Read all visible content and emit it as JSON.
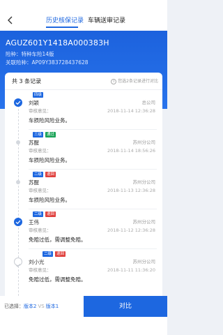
{
  "nav": {
    "tabs": [
      {
        "label": "历史核保记录"
      },
      {
        "label": "车辆送审记录"
      }
    ]
  },
  "header": {
    "title": "AGUZ601Y1418A000383H",
    "risk_label": "险种：",
    "risk_value": "特种车险14版",
    "related_label": "关联险种：",
    "related_value": "AP09Y383728437628"
  },
  "list": {
    "count_text": "共 3 条记录",
    "tip_icon": "i",
    "tip_text": "您选2条记录进行对比",
    "opinion_label": "审核意见：",
    "records": [
      {
        "badges": [
          "四级"
        ],
        "badge_colors": [
          "#1d67e0"
        ],
        "name": "刘颖",
        "company": "总公司",
        "time": "2018-11-14 12:36:28",
        "opinion": "车损险风险业务。",
        "state": "checked"
      },
      {
        "badges": [
          "三级",
          "通过"
        ],
        "badge_colors": [
          "#1d67e0",
          "#1aa357"
        ],
        "name": "苏醒",
        "company": "苏州分公司",
        "time": "2018-11-14 18:56:26",
        "opinion": "车损险风险业务。",
        "state": "dot"
      },
      {
        "badges": [
          "二级",
          "退回"
        ],
        "badge_colors": [
          "#1d67e0",
          "#e0413e"
        ],
        "name": "苏醒",
        "company": "苏州分公司",
        "time": "2018-11-13 12:36:28",
        "opinion": "车损险风险业务。",
        "state": "dot"
      },
      {
        "badges": [
          "二级",
          "退回"
        ],
        "badge_colors": [
          "#1d67e0",
          "#e0413e"
        ],
        "name": "王伟",
        "company": "苏州分公司",
        "time": "2018-11-12 12:36:28",
        "opinion": "免赔过低，需调整免赔。",
        "state": "checked"
      },
      {
        "badges": [
          "二级",
          "退回"
        ],
        "badge_colors": [
          "#1d67e0",
          "#e0413e"
        ],
        "name": "刘小光",
        "company": "苏州分公司",
        "time": "2018-11-11 11:36:20",
        "opinion": "免赔过低，需调整免赔。",
        "state": "circle"
      }
    ]
  },
  "bottom": {
    "selected_label": "已选择：",
    "version_a": "版本2",
    "vs": "VS",
    "version_b": "版本1",
    "compare_label": "对比"
  },
  "colors": {
    "accent": "#1d67e0",
    "pass": "#1aa357",
    "returned": "#e0413e"
  }
}
